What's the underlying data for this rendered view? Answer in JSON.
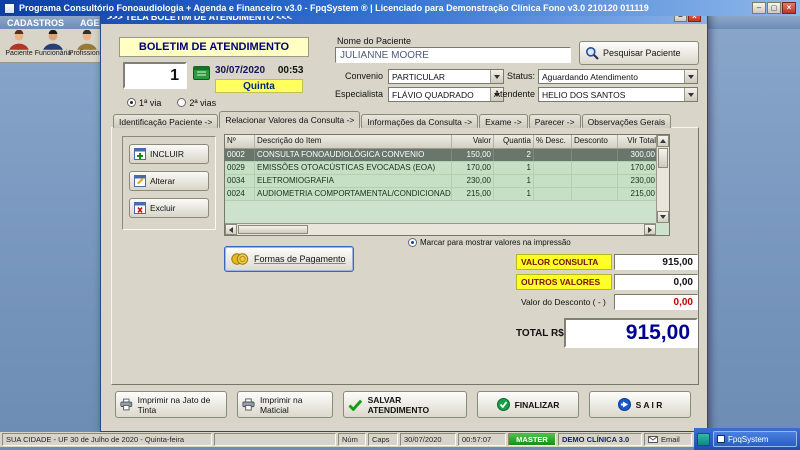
{
  "window": {
    "title": "Programa Consultório Fonoaudiologia + Agenda e Financeiro v3.0 - FpqSystem ® | Licenciado para Demonstração Clínica Fono v3.0 210120 011119",
    "menu": [
      "CADASTROS",
      "AGENDAMENTO"
    ],
    "toolbar": [
      "Paciente",
      "Funcionária",
      "Profissional"
    ]
  },
  "dialog": {
    "titlebar": ">>>   TELA BOLETIM DE ATENDIMENTO   <<<",
    "header": "BOLETIM DE ATENDIMENTO",
    "record_number": "1",
    "date": "30/07/2020",
    "time": "00:53",
    "weekday": "Quinta",
    "via_options": [
      "1ª via",
      "2ª vias"
    ],
    "patient": {
      "label": "Nome do Paciente",
      "value": "JULIANNE MOORE"
    },
    "search_button": "Pesquisar Paciente",
    "convenio": {
      "label": "Convenio",
      "value": "PARTICULAR"
    },
    "status": {
      "label": "Status:",
      "value": "Aguardando Atendimento"
    },
    "especialista": {
      "label": "Especialista",
      "value": "FLÁVIO QUADRADO"
    },
    "atendente": {
      "label": "Atendente",
      "value": "HELIO DOS SANTOS"
    },
    "tabs": [
      "Identificação Paciente ->",
      "Relacionar Valores da Consulta ->",
      "Informações da Consulta ->",
      "Exame ->",
      "Parecer ->",
      "Observações Gerais"
    ],
    "side_buttons": [
      "INCLUIR",
      "Alterar",
      "Excluir"
    ],
    "table": {
      "headers": [
        "Nº",
        "Descrição do Item",
        "Valor",
        "Quantia",
        "% Desc.",
        "Desconto",
        "Vlr Total"
      ],
      "rows": [
        [
          "0002",
          "CONSULTA FONOAUDIOLÓGICA CONVENIO",
          "150,00",
          "2",
          "",
          "",
          "300,00"
        ],
        [
          "0029",
          "EMISSÕES OTOACÚSTICAS EVOCADAS (EOA)",
          "170,00",
          "1",
          "",
          "",
          "170,00"
        ],
        [
          "0034",
          "ELETROMIOGRAFIA",
          "230,00",
          "1",
          "",
          "",
          "230,00"
        ],
        [
          "0024",
          "AUDIOMETRIA COMPORTAMENTAL/CONDICIONADA",
          "215,00",
          "1",
          "",
          "",
          "215,00"
        ]
      ]
    },
    "payment_button": "Formas de Pagamento",
    "print_option": "Marcar para mostrar valores na impressão",
    "totals": {
      "valor_consulta_label": "VALOR CONSULTA",
      "valor_consulta": "915,00",
      "outros_label": "OUTROS VALORES",
      "outros": "0,00",
      "desconto_label": "Valor do Desconto ( - )",
      "desconto": "0,00",
      "total_label": "TOTAL R$",
      "total": "915,00"
    },
    "bottom_buttons": [
      "Imprimir na Jato de Tinta",
      "Imprimir na Maticial",
      "SALVAR ATENDIMENTO",
      "FINALIZAR",
      "S A I R"
    ]
  },
  "statusbar": {
    "location": "SUA CIDADE - UF 30 de Julho de 2020 - Quinta-feira",
    "num": "Núm",
    "caps": "Caps",
    "date": "30/07/2020",
    "time": "00:57:07",
    "master": "MASTER",
    "clinic": "DEMO CLÍNICA 3.0",
    "email": "Email"
  },
  "taskbar": {
    "app": "FpqSystem"
  },
  "colors": {
    "titlebar_blue": "#2e6fd0",
    "dialog_bg": "#d9d5c9",
    "row_green": "#c6e0c6",
    "selected_row": "#68766b",
    "highlight_yellow": "#ffff28",
    "weekday_yellow": "#ffff5e",
    "total_navy": "#000090",
    "discount_red": "#c00000",
    "master_green": "#22a022"
  },
  "icons": {
    "search": "magnifier",
    "calendar": "green-calendar",
    "payment": "gold-coins",
    "save": "green-check",
    "exit": "blue-circle-arrow",
    "print": "printer",
    "email": "envelope"
  }
}
